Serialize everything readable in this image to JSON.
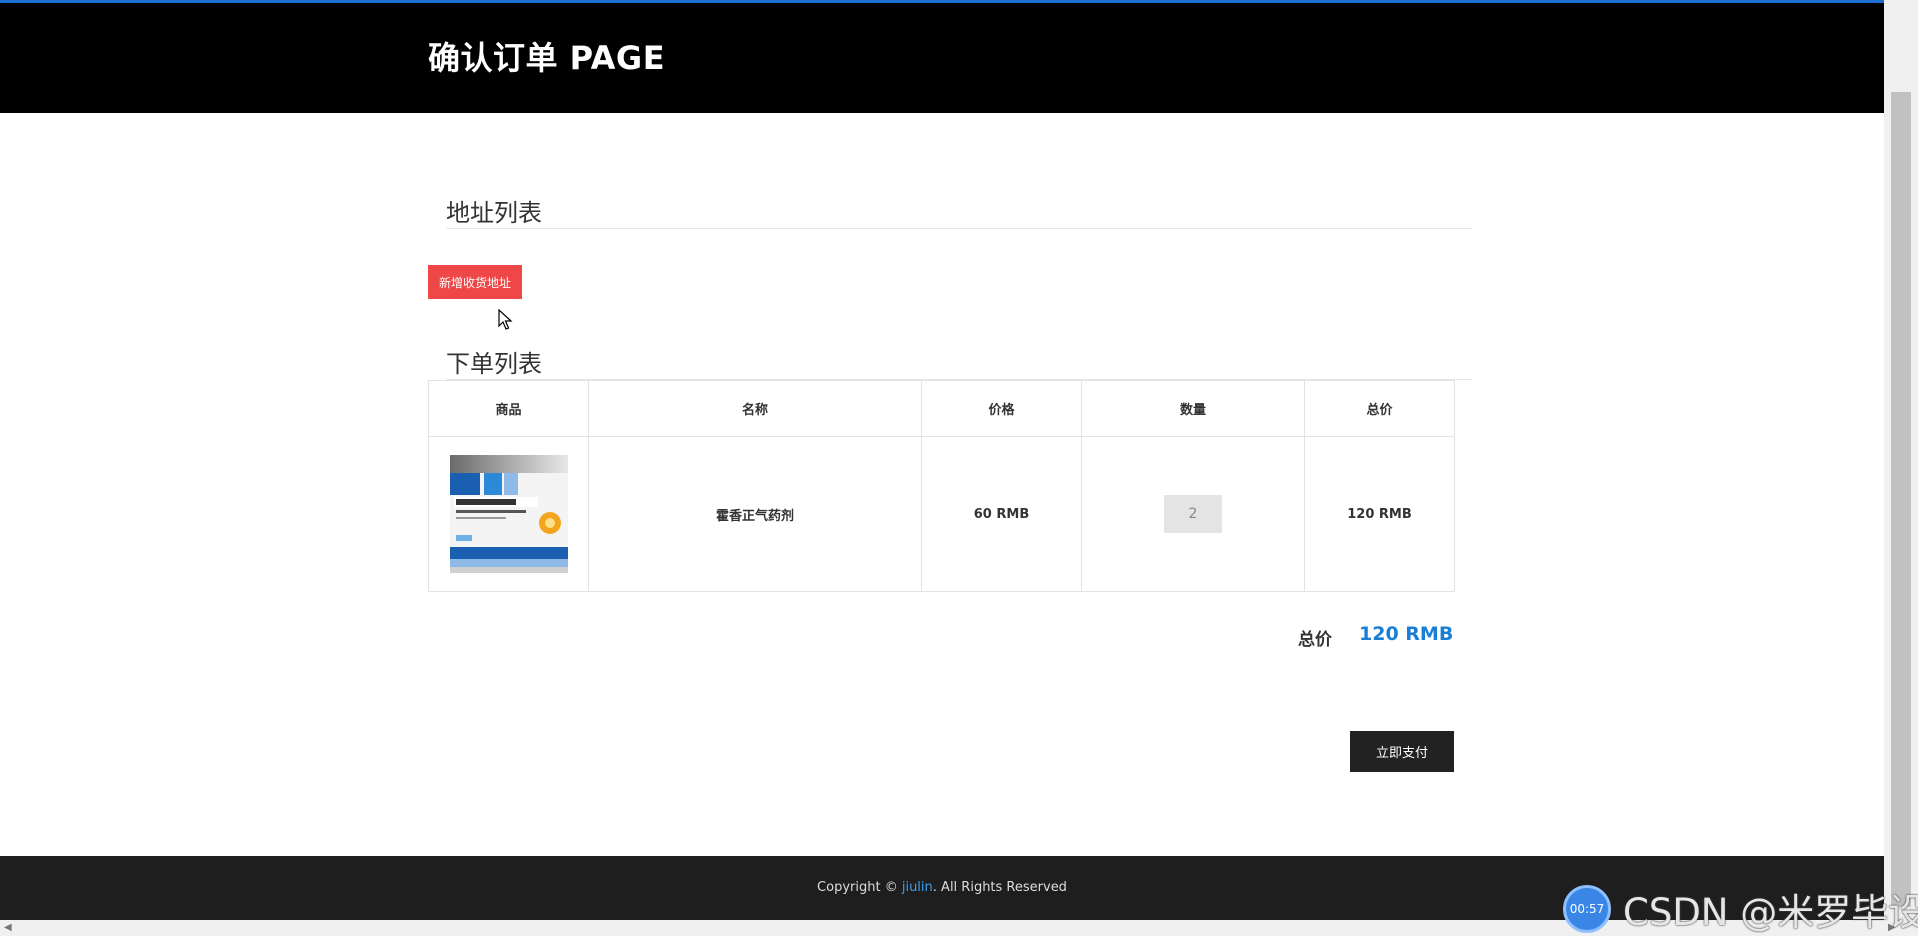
{
  "header": {
    "title": "确认订单 PAGE"
  },
  "address_section": {
    "title": "地址列表",
    "add_button": "新增收货地址"
  },
  "order_section": {
    "title": "下单列表",
    "columns": [
      "商品",
      "名称",
      "价格",
      "数量",
      "总价"
    ],
    "rows": [
      {
        "name": "霍香正气药剂",
        "price": "60 RMB",
        "quantity": "2",
        "total": "120 RMB"
      }
    ]
  },
  "summary": {
    "total_label": "总价",
    "total_value": "120 RMB"
  },
  "pay_button": "立即支付",
  "footer": {
    "prefix": "Copyright © ",
    "link": "jiulin",
    "suffix": ". All Rights Reserved"
  },
  "overlay": {
    "timer": "00:57",
    "watermark": "CSDN @米罗毕设"
  },
  "colors": {
    "accent": "#1a7fd4",
    "add_button": "#ef4747",
    "header": "#000000",
    "footer": "#1e1e1e"
  }
}
